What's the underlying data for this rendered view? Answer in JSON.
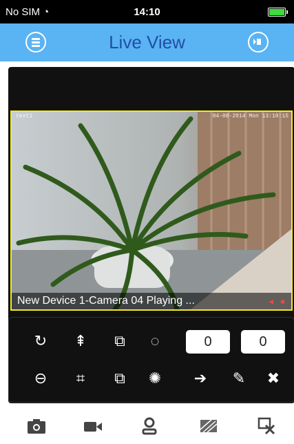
{
  "status_bar": {
    "carrier": "No SIM",
    "time": "14:10"
  },
  "nav": {
    "title": "Live View",
    "menu_icon": "menu-icon",
    "playback_icon": "playback-icon"
  },
  "video": {
    "caption": "New Device 1-Camera 04  Playing ...",
    "osd_left": "text1",
    "osd_right": "04-08-2014 Mon 13:10:15"
  },
  "controls": {
    "value_1": "0",
    "value_2": "0"
  },
  "toolbar": {
    "icons": [
      "camera-snapshot-icon",
      "video-record-icon",
      "user-icon",
      "image-quality-icon",
      "close-window-icon"
    ]
  },
  "colors": {
    "nav_bg": "#5ab3f3",
    "title": "#1f4fa6",
    "selection_border": "#f2ea20",
    "panel_bg": "#111112"
  }
}
